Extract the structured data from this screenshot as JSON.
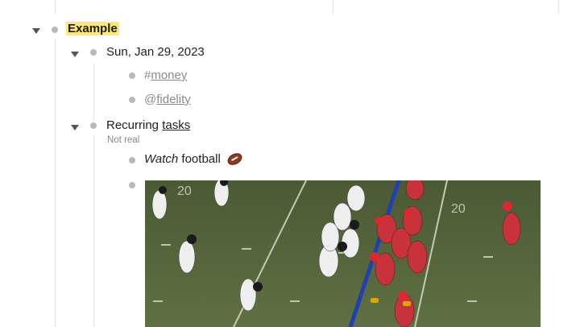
{
  "outline": {
    "root": {
      "label": "Example"
    },
    "date_node": {
      "label": "Sun, Jan 29, 2023",
      "children": [
        {
          "prefix": "#",
          "label": "money"
        },
        {
          "prefix": "@",
          "label": "fidelity"
        }
      ]
    },
    "recurring_node": {
      "label_prefix": "Recurring",
      "label_link": "tasks",
      "note": "Not real",
      "children": [
        {
          "label_italic": "Watch",
          "label_rest": "football",
          "emoji": "football-icon"
        },
        {
          "image": "football-game-photo"
        }
      ]
    }
  },
  "colors": {
    "highlight": "#fbe874",
    "tag_text": "#8a8a8a",
    "bullet": "#b9b9b9",
    "field": "#55663a",
    "scrimmage_line": "#1f3fb3"
  }
}
